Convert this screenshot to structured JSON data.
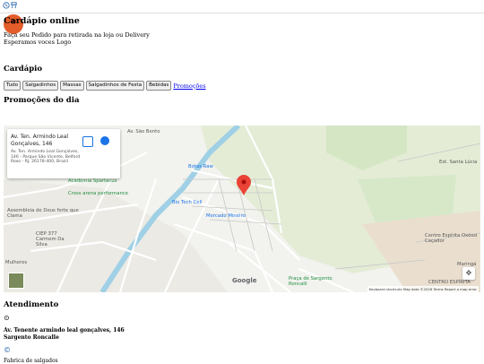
{
  "topbar": {
    "whatsapp_icon": "whatsapp-icon",
    "cart_icon": "cart-icon"
  },
  "hero": {
    "title": "Cardápio online",
    "line1": "Faça seu Pedido para retirada na loja ou Delivery",
    "line2": "Esperamos voces Logo"
  },
  "menu": {
    "heading": "Cardápio",
    "tabs": [
      "Tudo",
      "Salgadinhos",
      "Massas",
      "Salgadinhos de Festa",
      "Bebidas"
    ],
    "promo_link": "Promoções"
  },
  "promos": {
    "heading": "Promoções do dia"
  },
  "map": {
    "card_title": "Av. Ten. Armindo Leal Gonçalves, 146",
    "card_address": "Av. Ten. Armindo Leal Gonçalves, 146 - Parque São Vicente, Belford Roxo - RJ, 26178-400, Brazil",
    "google": "Google",
    "attribution": "Keyboard shortcuts   Map data ©2026   Terms   Report a map error",
    "labels": {
      "academia": "Academia Spartacus",
      "cross": "Cross arena performance",
      "biotech": "Bio Tech Cell",
      "mercado": "Mercado Mineiro",
      "botas": "Botas Raw",
      "assembleia": "Assembleia de Deus forte que Clama",
      "ciep": "CIEP 377 Carmem Da Silva",
      "centro1": "Centro Espírita Oxóssi Caçador",
      "praca": "Praça de Sargento Roncalli",
      "centro2": "CENTRO ESPÍRITA",
      "mulheres": "Mulheres",
      "maringa": "Maringá",
      "sao_bento": "Av. São Bento",
      "santa_lucia": "Est. Santa Lúcia"
    }
  },
  "service": {
    "heading": "Atendimento",
    "address_line1": "Av. Tenente armindo leal gonçalves, 146",
    "address_line2": "Sargento Roncalle",
    "hours_label": "Fabrica de salgados"
  }
}
